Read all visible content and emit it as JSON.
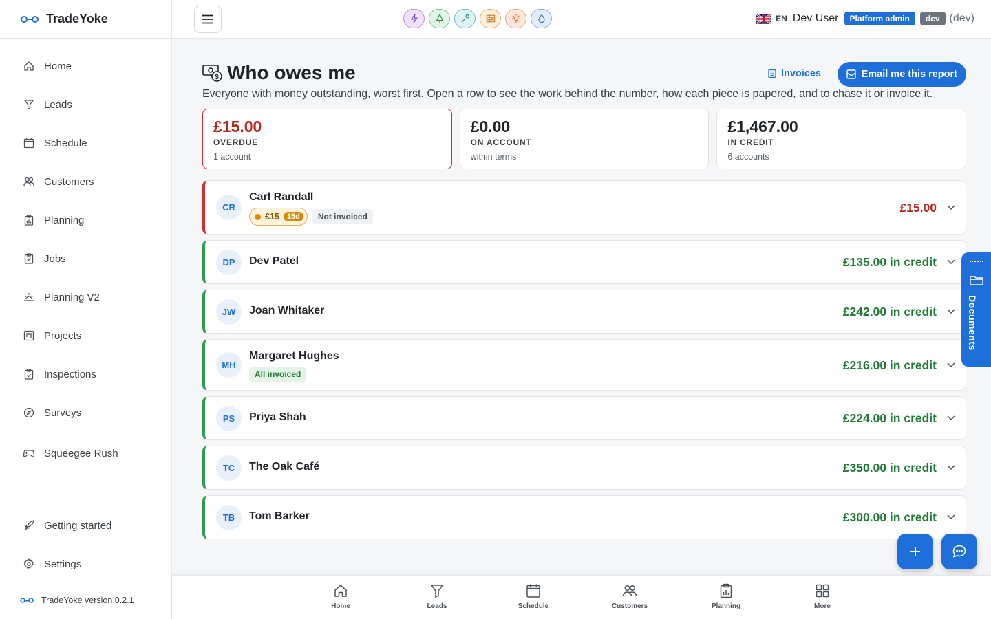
{
  "app": {
    "name": "TradeYoke",
    "version_text": "TradeYoke version 0.2.1"
  },
  "sidebar": {
    "items": [
      {
        "label": "Home",
        "icon": "home-icon"
      },
      {
        "label": "Leads",
        "icon": "filter-icon"
      },
      {
        "label": "Schedule",
        "icon": "calendar-icon"
      },
      {
        "label": "Customers",
        "icon": "people-icon"
      },
      {
        "label": "Planning",
        "icon": "clipboard-chart-icon"
      },
      {
        "label": "Jobs",
        "icon": "clipboard-icon"
      },
      {
        "label": "Planning V2",
        "icon": "sunrise-icon"
      },
      {
        "label": "Projects",
        "icon": "kanban-icon"
      },
      {
        "label": "Inspections",
        "icon": "clipboard-check-icon"
      },
      {
        "label": "Surveys",
        "icon": "compass-icon"
      },
      {
        "label": "Squeegee Rush",
        "icon": "gamepad-icon"
      }
    ],
    "bottom_items": [
      {
        "label": "Getting started",
        "icon": "rocket-icon"
      },
      {
        "label": "Settings",
        "icon": "gear-icon"
      }
    ]
  },
  "topbar": {
    "lang": "EN",
    "user": "Dev User",
    "role_badge": "Platform admin",
    "env_badge": "dev",
    "env_text": "(dev)",
    "trade_icons": [
      "lightning-icon",
      "tree-icon",
      "wrench-icon",
      "bricks-icon",
      "sun-icon",
      "droplet-icon"
    ]
  },
  "page": {
    "title": "Who owes me",
    "subtitle": "Everyone with money outstanding, worst first. Open a row to see the work behind the number, how each piece is papered, and to chase it or invoice it.",
    "invoices_link": "Invoices",
    "email_button": "Email me this report"
  },
  "stats": [
    {
      "amount": "£15.00",
      "label": "OVERDUE",
      "sub": "1 account"
    },
    {
      "amount": "£0.00",
      "label": "ON ACCOUNT",
      "sub": "within terms"
    },
    {
      "amount": "£1,467.00",
      "label": "IN CREDIT",
      "sub": "6 accounts"
    }
  ],
  "customers": [
    {
      "initials": "CR",
      "name": "Carl Randall",
      "amount": "£15.00",
      "owed_tag": "£15",
      "days_tag": "15d",
      "status_tag": "Not invoiced"
    },
    {
      "initials": "DP",
      "name": "Dev Patel",
      "amount": "£135.00 in credit"
    },
    {
      "initials": "JW",
      "name": "Joan Whitaker",
      "amount": "£242.00 in credit"
    },
    {
      "initials": "MH",
      "name": "Margaret Hughes",
      "amount": "£216.00 in credit",
      "status_tag": "All invoiced"
    },
    {
      "initials": "PS",
      "name": "Priya Shah",
      "amount": "£224.00 in credit"
    },
    {
      "initials": "TC",
      "name": "The Oak Café",
      "amount": "£350.00 in credit"
    },
    {
      "initials": "TB",
      "name": "Tom Barker",
      "amount": "£300.00 in credit"
    }
  ],
  "documents_tab": "Documents",
  "bottom_nav": [
    {
      "label": "Home",
      "icon": "home-icon"
    },
    {
      "label": "Leads",
      "icon": "filter-icon"
    },
    {
      "label": "Schedule",
      "icon": "calendar-icon"
    },
    {
      "label": "Customers",
      "icon": "people-icon"
    },
    {
      "label": "Planning",
      "icon": "clipboard-chart-icon"
    },
    {
      "label": "More",
      "icon": "grid-icon"
    }
  ],
  "colors": {
    "accent": "#1e6fd9",
    "overdue": "#b3261e",
    "credit": "#1f7a35"
  }
}
